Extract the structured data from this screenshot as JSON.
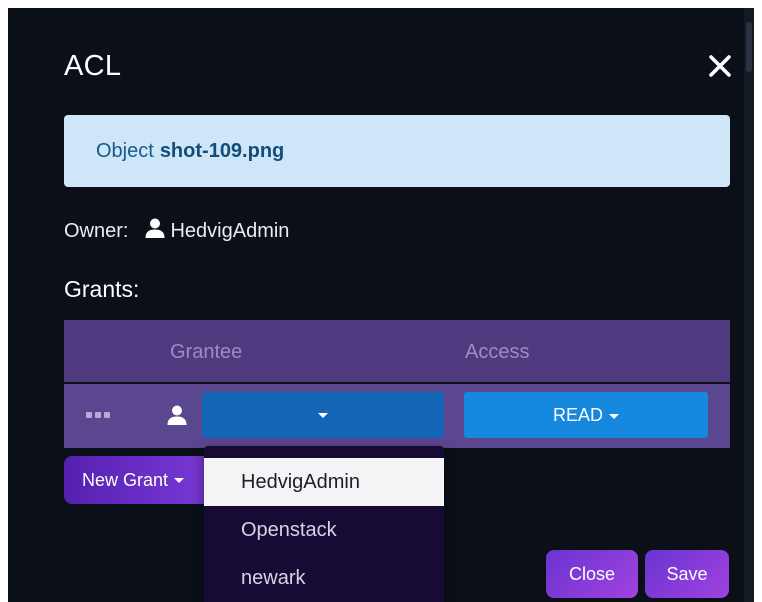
{
  "modal": {
    "title": "ACL",
    "close_icon": "close-icon"
  },
  "object_info": {
    "label": "Object",
    "filename": "shot-109.png"
  },
  "owner": {
    "label": "Owner:",
    "name": "HedvigAdmin",
    "icon": "user-icon"
  },
  "grants": {
    "title": "Grants:",
    "columns": [
      "Grantee",
      "Access"
    ],
    "row": {
      "grantee_value": "",
      "access_value": "READ"
    },
    "new_grant_label": "New Grant"
  },
  "grantee_dropdown": {
    "options": [
      "HedvigAdmin",
      "Openstack",
      "newark"
    ],
    "highlighted": "HedvigAdmin"
  },
  "footer": {
    "close_label": "Close",
    "save_label": "Save"
  },
  "colors": {
    "modal_bg": "#0a0f18",
    "info_bg": "#cfe6f9",
    "table_header": "#4f3a80",
    "table_row": "#5b4690",
    "select_blue": "#1565b7",
    "access_blue": "#1688dd",
    "button_purple": "#7a3ad8"
  }
}
